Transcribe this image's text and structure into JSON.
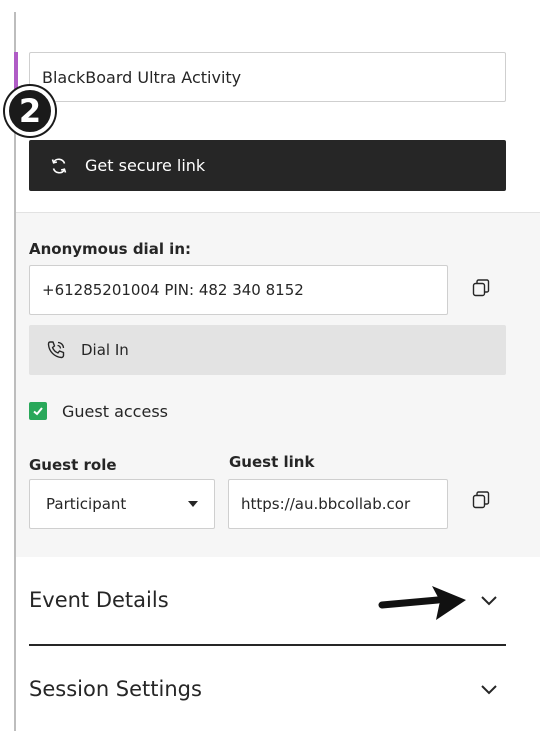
{
  "activity": {
    "title_value": "BlackBoard Ultra Activity"
  },
  "step_badge": "2",
  "secure_link": {
    "label": "Get secure link",
    "icon": "refresh-icon"
  },
  "dial_in": {
    "heading": "Anonymous dial in:",
    "number_value": "+61285201004 PIN: 482 340 8152",
    "copy_icon": "copy-icon",
    "button_label": "Dial In",
    "button_icon": "phone-icon"
  },
  "guest": {
    "access_label": "Guest access",
    "access_checked": true,
    "role_heading": "Guest role",
    "role_value": "Participant",
    "link_heading": "Guest link",
    "link_value": "https://au.bbcollab.cor"
  },
  "sections": {
    "event_details": "Event Details",
    "session_settings": "Session Settings"
  },
  "colors": {
    "accent": "#b05cc6",
    "dark_button": "#262626",
    "checkbox": "#29a85a"
  }
}
